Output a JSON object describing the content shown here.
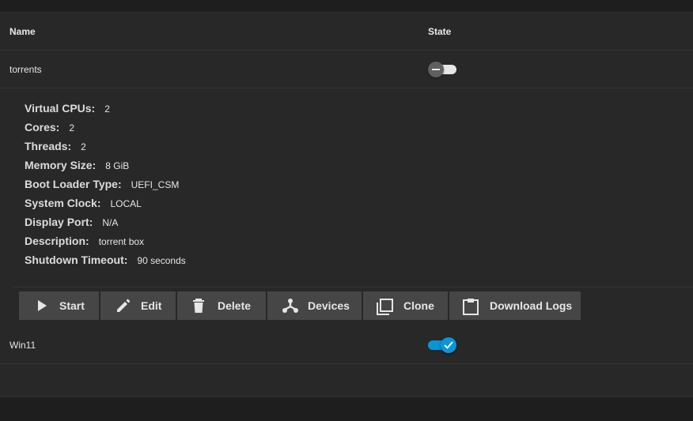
{
  "table": {
    "headers": {
      "name": "Name",
      "state": "State"
    }
  },
  "vms": [
    {
      "name": "torrents",
      "running": false
    },
    {
      "name": "Win11",
      "running": true
    }
  ],
  "details": [
    {
      "label": "Virtual CPUs:",
      "value": "2"
    },
    {
      "label": "Cores:",
      "value": "2"
    },
    {
      "label": "Threads:",
      "value": "2"
    },
    {
      "label": "Memory Size:",
      "value": "8 GiB"
    },
    {
      "label": "Boot Loader Type:",
      "value": "UEFI_CSM"
    },
    {
      "label": "System Clock:",
      "value": "LOCAL"
    },
    {
      "label": "Display Port:",
      "value": "N/A"
    },
    {
      "label": "Description:",
      "value": "torrent box"
    },
    {
      "label": "Shutdown Timeout:",
      "value": "90 seconds"
    }
  ],
  "actions": {
    "start": "Start",
    "edit": "Edit",
    "delete": "Delete",
    "devices": "Devices",
    "clone": "Clone",
    "download_logs": "Download Logs"
  },
  "colors": {
    "accent": "#0a95d8",
    "panel": "#282828",
    "background": "#1e1e1e",
    "button": "#464646"
  },
  "icons": {
    "start": "play-icon",
    "edit": "pencil-icon",
    "delete": "trash-icon",
    "devices": "device-tree-icon",
    "clone": "copy-icon",
    "download_logs": "clipboard-icon"
  }
}
